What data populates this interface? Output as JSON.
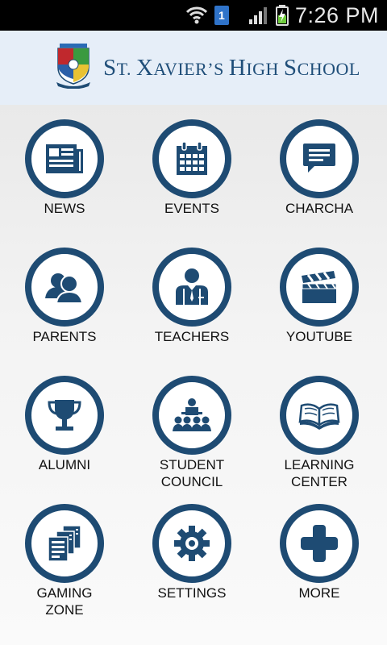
{
  "status_bar": {
    "time": "7:26 PM",
    "notification_count": "1",
    "icons": [
      "wifi-icon",
      "notification-badge-icon",
      "signal-icon",
      "battery-charging-icon"
    ]
  },
  "header": {
    "logo": "school-crest-icon",
    "title_prefix_big": "S",
    "title_rest": "T. ",
    "title_x_big": "X",
    "title_avier": "AVIER’S ",
    "title_h_big": "H",
    "title_igh": "IGH ",
    "title_s_big": "S",
    "title_chool": "CHOOL",
    "brand_color": "#1e4b73"
  },
  "tiles": [
    {
      "label": "NEWS",
      "icon": "newspaper-icon"
    },
    {
      "label": "EVENTS",
      "icon": "calendar-icon"
    },
    {
      "label": "CHARCHA",
      "icon": "chat-bubble-icon"
    },
    {
      "label": "PARENTS",
      "icon": "people-icon"
    },
    {
      "label": "TEACHERS",
      "icon": "teacher-icon"
    },
    {
      "label": "YOUTUBE",
      "icon": "clapperboard-icon"
    },
    {
      "label": "ALUMNI",
      "icon": "trophy-icon"
    },
    {
      "label": "STUDENT\nCOUNCIL",
      "icon": "council-icon"
    },
    {
      "label": "LEARNING\nCENTER",
      "icon": "open-book-icon"
    },
    {
      "label": "GAMING\nZONE",
      "icon": "documents-icon"
    },
    {
      "label": "SETTINGS",
      "icon": "gear-icon"
    },
    {
      "label": "MORE",
      "icon": "plus-icon"
    }
  ]
}
